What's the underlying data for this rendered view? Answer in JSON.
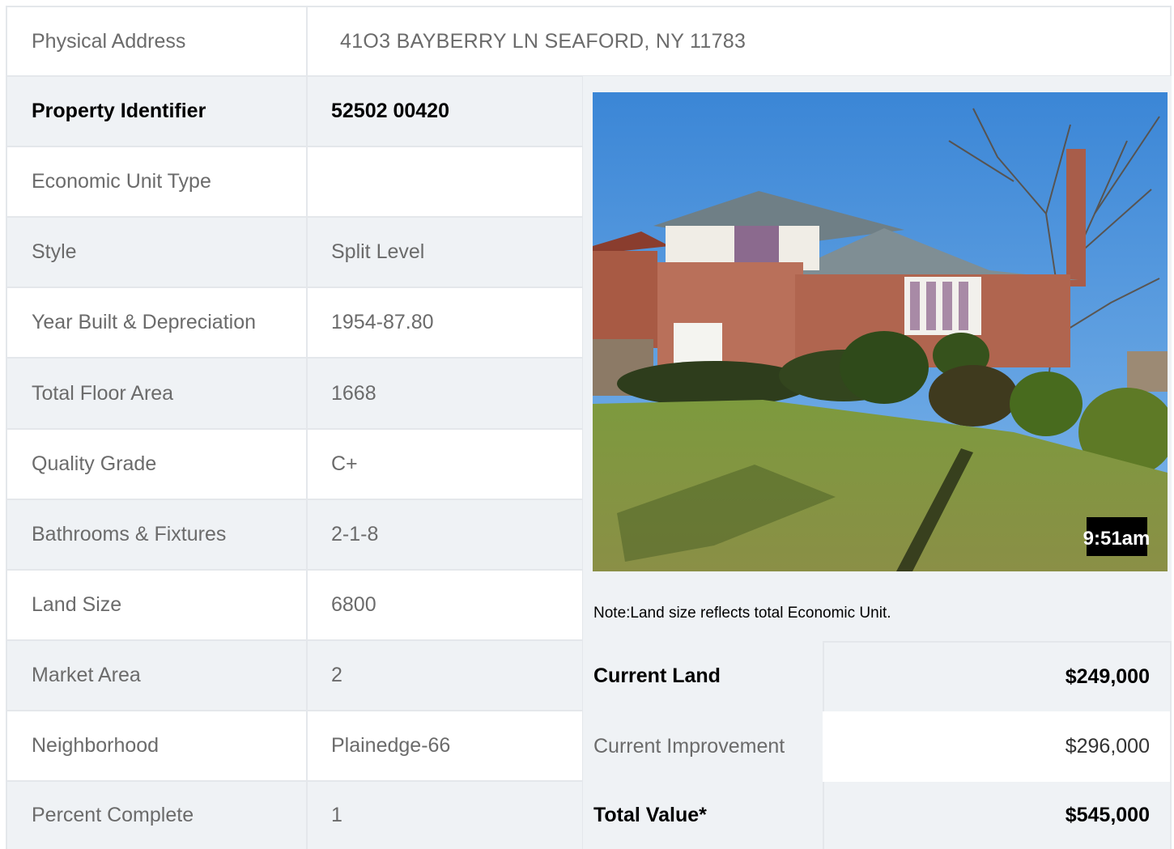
{
  "address": {
    "label": "Physical Address",
    "value": "41O3  BAYBERRY LN  SEAFORD, NY  11783"
  },
  "rows": [
    {
      "label": "Property Identifier",
      "value": "52502  00420"
    },
    {
      "label": "Economic Unit Type",
      "value": ""
    },
    {
      "label": "Style",
      "value": "Split Level"
    },
    {
      "label": "Year Built & Depreciation",
      "value": "1954-87.80"
    },
    {
      "label": "Total Floor Area",
      "value": "1668"
    },
    {
      "label": "Quality Grade",
      "value": "C+"
    },
    {
      "label": "Bathrooms & Fixtures",
      "value": "2-1-8"
    },
    {
      "label": "Land Size",
      "value": "6800"
    },
    {
      "label": "Market Area",
      "value": "2"
    },
    {
      "label": "Neighborhood",
      "value": "Plainedge-66"
    },
    {
      "label": "Percent Complete",
      "value": "1"
    }
  ],
  "photo": {
    "timestamp": "9:51am"
  },
  "note": "Note:Land size reflects total Economic Unit.",
  "valuation": {
    "current_land_label": "Current Land",
    "current_land_value": "$249,000",
    "current_improvement_label": "Current Improvement",
    "current_improvement_value": "$296,000",
    "total_value_label": "Total Value*",
    "total_value_value": "$545,000"
  }
}
